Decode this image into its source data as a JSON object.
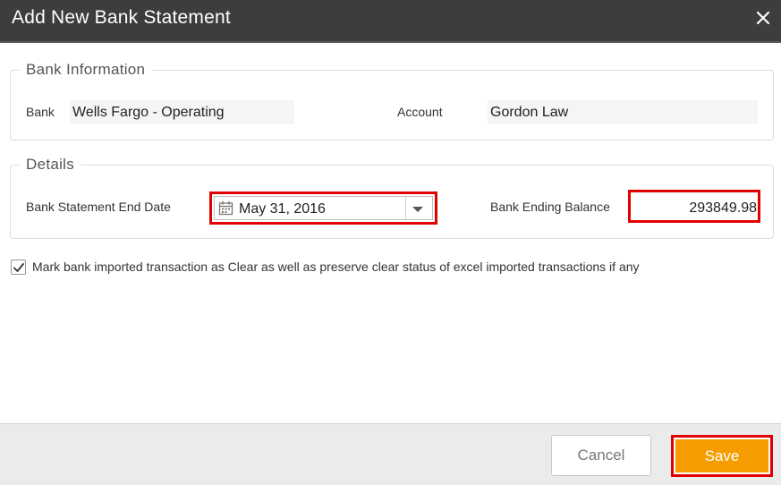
{
  "dialog": {
    "title": "Add New Bank Statement",
    "close_icon": "close-icon"
  },
  "bank_info": {
    "legend": "Bank Information",
    "bank_label": "Bank",
    "bank_value": "Wells Fargo - Operating",
    "account_label": "Account",
    "account_value": "Gordon Law"
  },
  "details": {
    "legend": "Details",
    "end_date_label": "Bank Statement End Date",
    "end_date_value": "May 31, 2016",
    "ending_balance_label": "Bank Ending Balance",
    "ending_balance_value": "293849.98",
    "calendar_icon": "calendar-icon",
    "dropdown_icon": "caret-down-icon"
  },
  "options": {
    "mark_clear_label": "Mark bank imported transaction as Clear as well as preserve clear status of excel imported transactions if any",
    "mark_clear_checked": true
  },
  "footer": {
    "cancel_label": "Cancel",
    "save_label": "Save"
  },
  "colors": {
    "header_bg": "#3d3d3d",
    "save_bg": "#f59d00",
    "highlight": "#e00000"
  }
}
